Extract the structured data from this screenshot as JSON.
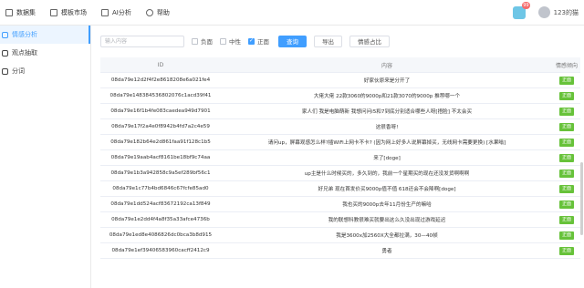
{
  "topnav": {
    "items": [
      {
        "label": "数据集",
        "icon": "database-icon"
      },
      {
        "label": "模板市场",
        "icon": "template-icon"
      },
      {
        "label": "AI分析",
        "icon": "ai-icon"
      },
      {
        "label": "帮助",
        "icon": "help-icon"
      }
    ],
    "notification_count": "99",
    "username": "123的猫"
  },
  "sidebar": {
    "items": [
      {
        "label": "情感分析",
        "active": true
      },
      {
        "label": "观点抽取",
        "active": false
      },
      {
        "label": "分词",
        "active": false
      }
    ]
  },
  "toolbar": {
    "search_placeholder": "输入内容",
    "filters": [
      {
        "label": "负面",
        "checked": false
      },
      {
        "label": "中性",
        "checked": false
      },
      {
        "label": "正面",
        "checked": true
      }
    ],
    "query_label": "查询",
    "export_label": "导出",
    "ratio_label": "情感占比"
  },
  "table": {
    "headers": {
      "id": "ID",
      "content": "内容",
      "tag": "情感倾向"
    },
    "rows": [
      {
        "id": "08da79e12d2f4f2e8618208e6a021fe4",
        "content": "好家伙原来是分开了",
        "tag": "正面"
      },
      {
        "id": "08da79e148384536802076c1acd39f41",
        "content": "大佬大佬 22款3060的9000p和21款3070的9000p 推荐哪一个",
        "tag": "正面"
      },
      {
        "id": "08da79e16f1b4fe083caedea949d7901",
        "content": "家人们 我是电脑萌新 我想问问i5和7到底分别适合哪些人呀[捂脸] 不太会买",
        "tag": "正面"
      },
      {
        "id": "08da79e17f2a4e0f8942b4fd7a2c4e59",
        "content": "这很香呀!",
        "tag": "正面"
      },
      {
        "id": "08da79e182b64e2d861faa91f128c1b5",
        "content": "请问up，屏幕观感怎么样?插WiFi上网卡不卡? (因为网上好多人说屏幕掉买，无线网卡需要更换) [水果嗡]",
        "tag": "正面"
      },
      {
        "id": "08da79e19aab4acf8161be18bf9c74aa",
        "content": "来了[doge]",
        "tag": "正面"
      },
      {
        "id": "08da79e1b3a942858c9a5ef289bf56c1",
        "content": "up主是什么时候买的，多久到的，我前一个星期买的现在还没发货啊啊啊",
        "tag": "正面"
      },
      {
        "id": "08da79e1c77b4bd6846c67fcfe85ad0",
        "content": "好兄弟 现在首发价买9000p值不值 618还会不会降啊[doge]",
        "tag": "正面"
      },
      {
        "id": "08da79e1dd524acf83672192ca13f849",
        "content": "我也买的9000p去年11月份生产的嘛哈",
        "tag": "正面"
      },
      {
        "id": "08da79e1e2dd4f4a8f35a33afce4736b",
        "content": "我的联想科教很难买就要出这么久没出现过游戏延迟",
        "tag": "正面"
      },
      {
        "id": "08da79e1ed8e4086826dc0bca3b8d915",
        "content": "我是3600x加2560X大全都拉满，30—40帧",
        "tag": "正面"
      },
      {
        "id": "08da79e1ef39406583960cacff2412c9",
        "content": "勇者",
        "tag": "正面"
      }
    ]
  }
}
